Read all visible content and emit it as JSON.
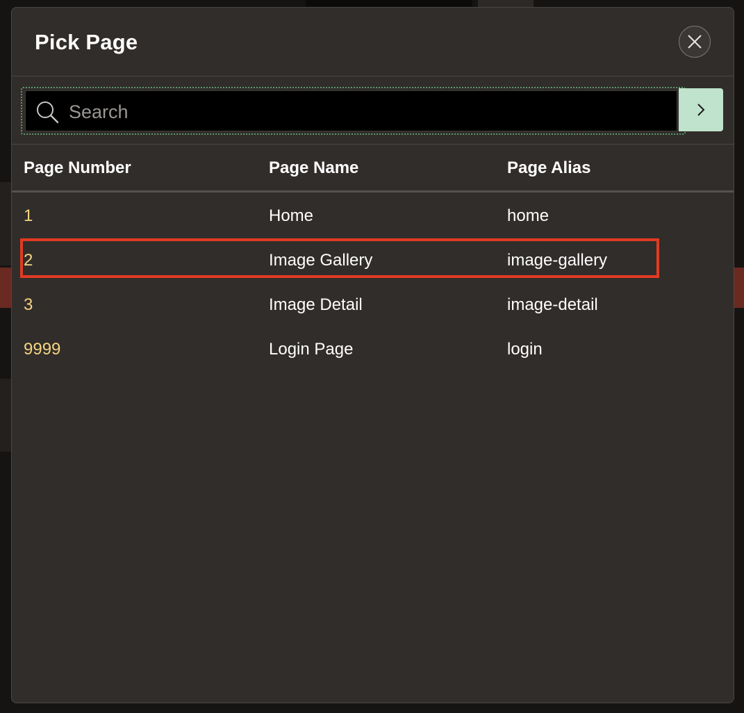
{
  "dialog": {
    "title": "Pick Page",
    "close_icon": "close-icon"
  },
  "search": {
    "placeholder": "Search",
    "value": "",
    "search_icon": "search-icon",
    "go_icon": "chevron-right-icon"
  },
  "table": {
    "headers": [
      "Page Number",
      "Page Name",
      "Page Alias"
    ],
    "rows": [
      {
        "number": "1",
        "name": "Home",
        "alias": "home"
      },
      {
        "number": "2",
        "name": "Image Gallery",
        "alias": "image-gallery"
      },
      {
        "number": "3",
        "name": "Image Detail",
        "alias": "image-detail"
      },
      {
        "number": "9999",
        "name": "Login Page",
        "alias": "login"
      }
    ],
    "highlighted_row": 1
  },
  "colors": {
    "number_text": "#f5d481",
    "highlight_border": "#e23a22",
    "go_button": "#bfe3cc",
    "dialog_bg": "#312d2a"
  }
}
